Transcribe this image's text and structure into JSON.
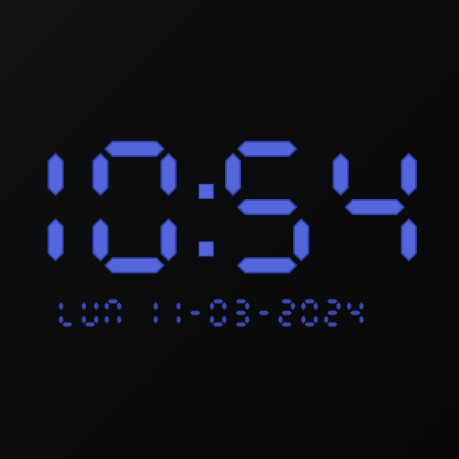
{
  "clock": {
    "time": "10:54",
    "date": "LUN 11-03-2024"
  },
  "colors": {
    "background": "#0b0d0f",
    "segment": "#5566dd",
    "segment_edge": "#3344aa",
    "date_text": "#3b4bb0"
  }
}
